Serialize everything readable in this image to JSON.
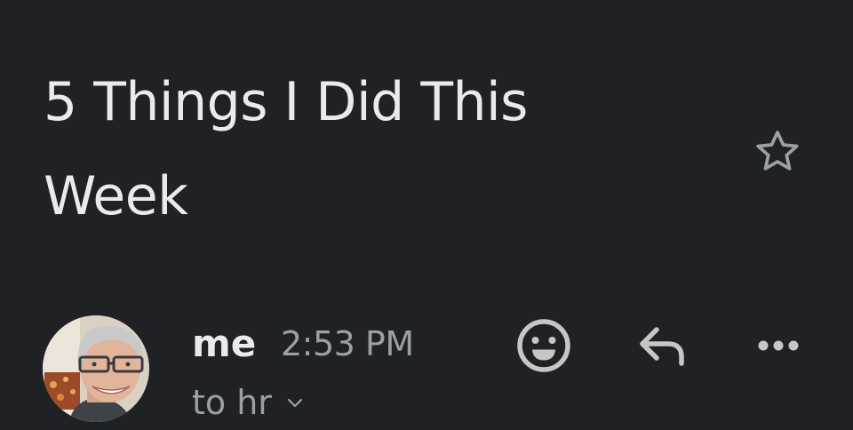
{
  "email": {
    "subject": "5 Things I Did This Week",
    "sender": "me",
    "time": "2:53 PM",
    "recipients": "to hr"
  },
  "icons": {
    "star": "star-outline-icon",
    "emoji": "emoji-reaction-icon",
    "reply": "reply-icon",
    "more": "more-horizontal-icon",
    "expand": "chevron-down-icon"
  },
  "colors": {
    "background": "#202124",
    "primary_text": "#e8eaed",
    "secondary_text": "#9aa0a6"
  }
}
